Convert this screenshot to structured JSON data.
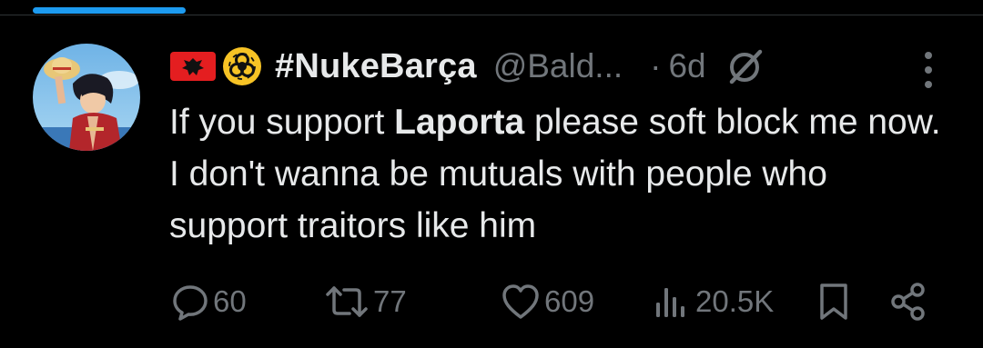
{
  "tweet": {
    "display_name": "#NukeBarça",
    "handle": "@Bald...",
    "dot": "·",
    "time": "6d",
    "text_before": "If you support ",
    "text_bold": "Laporta",
    "text_after": " please soft block me now. I don't wanna be mutuals with people who support traitors like him"
  },
  "actions": {
    "replies": "60",
    "reposts": "77",
    "likes": "609",
    "views": "20.5K"
  },
  "icons": {
    "flag": "albania-flag-icon",
    "biohazard": "biohazard-icon",
    "grok": "grok-icon",
    "more": "more-vertical-icon",
    "reply": "reply-icon",
    "repost": "repost-icon",
    "like": "heart-icon",
    "views": "views-icon",
    "bookmark": "bookmark-icon",
    "share": "share-icon"
  },
  "colors": {
    "background": "#000000",
    "text": "#e7e9ea",
    "muted": "#71767b",
    "accent": "#1d9bf0",
    "flag_red": "#e41e20",
    "biohazard_yellow": "#f7c325"
  }
}
